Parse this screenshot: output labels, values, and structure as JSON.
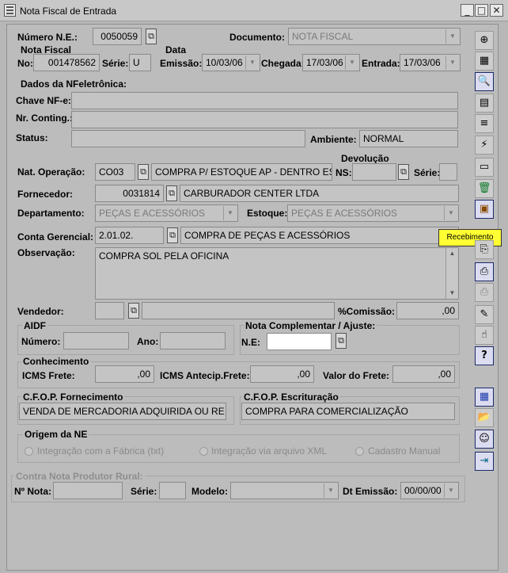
{
  "window": {
    "title": "Nota Fiscal de Entrada",
    "min_glyph": "_",
    "max_glyph": "□",
    "close_glyph": "✕"
  },
  "header": {
    "numero_ne_label": "Número N.E.:",
    "numero_ne_value": "0050059",
    "documento_label": "Documento:",
    "documento_value": "NOTA FISCAL",
    "nota_fiscal_title": "Nota Fiscal",
    "no_label": "No:",
    "no_value": "001478562",
    "serie_label": "Série:",
    "serie_value": "U",
    "data_title": "Data",
    "emissao_label": "Emissão:",
    "emissao_value": "10/03/06",
    "chegada_label": "Chegada:",
    "chegada_value": "17/03/06",
    "entrada_label": "Entrada:",
    "entrada_value": "17/03/06"
  },
  "nfe": {
    "title": "Dados da NFeletrônica:",
    "chave_label": "Chave NF-e:",
    "chave_value": "",
    "contingencia_label": "Nr. Conting.:",
    "contingencia_value": "",
    "status_label": "Status:",
    "status_value": "",
    "ambiente_label": "Ambiente:",
    "ambiente_value": "NORMAL"
  },
  "operacao": {
    "nat_label": "Nat. Operação:",
    "nat_code": "CO03",
    "nat_desc": "COMPRA P/ ESTOQUE AP - DENTRO ESTA",
    "devolucao_title": "Devolução",
    "ns_label": "NS:",
    "ns_value": "",
    "dev_serie_label": "Série:",
    "dev_serie_value": "",
    "fornecedor_label": "Fornecedor:",
    "fornecedor_code": "0031814",
    "fornecedor_name": "CARBURADOR  CENTER  LTDA",
    "departamento_label": "Departamento:",
    "departamento_value": "PEÇAS E ACESSÓRIOS",
    "estoque_label": "Estoque:",
    "estoque_value": "PEÇAS E ACESSÓRIOS",
    "conta_label": "Conta Gerencial:",
    "conta_code": "2.01.02.",
    "conta_desc": "COMPRA DE PEÇAS E ACESSÓRIOS",
    "observacao_label": "Observação:",
    "observacao_value": "COMPRA SOL PELA OFICINA",
    "vendedor_label": "Vendedor:",
    "vendedor_code": "",
    "vendedor_name": "",
    "comissao_label": "%Comissão:",
    "comissao_value": ",00"
  },
  "aidf": {
    "title": "AIDF",
    "numero_label": "Número:",
    "numero_value": "",
    "ano_label": "Ano:",
    "ano_value": ""
  },
  "complementar": {
    "title": "Nota Complementar / Ajuste:",
    "ne_label": "N.E:",
    "ne_value": ""
  },
  "conhecimento": {
    "title": "Conhecimento",
    "icms_frete_label": "ICMS Frete:",
    "icms_frete_value": ",00",
    "icms_antecip_label": "ICMS Antecip.Frete:",
    "icms_antecip_value": ",00",
    "valor_frete_label": "Valor do Frete:",
    "valor_frete_value": ",00"
  },
  "cfop": {
    "fornecimento_title": "C.F.O.P. Fornecimento",
    "fornecimento_value": "VENDA DE MERCADORIA ADQUIRIDA OU RE",
    "escrituracao_title": "C.F.O.P. Escrituração",
    "escrituracao_value": "COMPRA PARA COMERCIALIZAÇÃO"
  },
  "origem": {
    "title": "Origem da NE",
    "options": [
      "Integração com a Fábrica (txt)",
      "Integração via arquivo XML",
      "Cadastro Manual"
    ]
  },
  "produtor": {
    "title": "Contra Nota Produtor Rural:",
    "nota_label": "Nº Nota:",
    "nota_value": "",
    "serie_label": "Série:",
    "serie_value": "",
    "modelo_label": "Modelo:",
    "modelo_value": "",
    "dt_emissao_label": "Dt Emissão:",
    "dt_emissao_value": "00/00/00"
  },
  "toolbar": {
    "tooltip": "Recebimento",
    "icons": [
      "add-record-icon",
      "grid-icon",
      "search-doc-icon",
      "calculator-icon",
      "list-icon",
      "lightning-icon",
      "blank-icon",
      "trash-icon",
      "receipt-icon",
      "copy-icon",
      "print-icon",
      "print-preview-icon",
      "audit-icon",
      "hand-icon",
      "help-icon",
      "calendar-icon",
      "folder-open-icon",
      "people-icon",
      "exit-icon"
    ],
    "glyphs": [
      "⊕",
      "▦",
      "🔍",
      "▤",
      "≡",
      "⚡",
      "▭",
      "🗑",
      "▣",
      "⎘",
      "⎙",
      "⎙",
      "✎",
      "☝",
      "?",
      "▦",
      "📂",
      "☺",
      "⇥"
    ]
  }
}
